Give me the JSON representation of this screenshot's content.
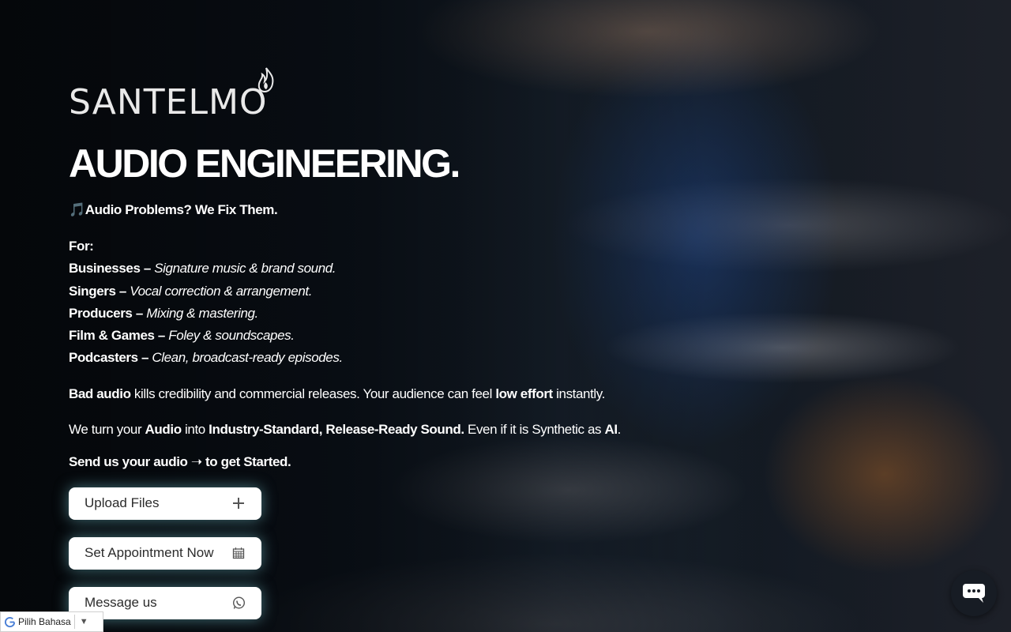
{
  "brand": {
    "logo_text": "SANTELMO"
  },
  "hero": {
    "headline": "AUDIO ENGINEERING.",
    "tagline": "🎵Audio Problems? We Fix Them."
  },
  "for_section": {
    "heading": "For:",
    "items": [
      {
        "name": "Businesses",
        "sep": " – ",
        "desc": "Signature music & brand sound."
      },
      {
        "name": "Singers",
        "sep": " – ",
        "desc": "Vocal correction & arrangement."
      },
      {
        "name": "Producers",
        "sep": " – ",
        "desc": "Mixing & mastering."
      },
      {
        "name": "Film & Games",
        "sep": " – ",
        "desc": "Foley & soundscapes."
      },
      {
        "name": "Podcasters",
        "sep": " – ",
        "desc": "Clean, broadcast-ready episodes."
      }
    ]
  },
  "para1": {
    "b1": "Bad audio",
    "t1": " kills credibility and commercial releases. Your audience can feel ",
    "b2": "low effort",
    "t2": " instantly."
  },
  "para2": {
    "t1": "We turn your ",
    "b1": "Audio",
    "t2": " into ",
    "b2": "Industry-Standard, Release-Ready Sound.",
    "t3": " Even if it is Synthetic as ",
    "b3": "AI",
    "t4": "."
  },
  "cta": "Send us your audio ➝ to get Started.",
  "buttons": {
    "upload": {
      "label": "Upload Files",
      "icon": "plus-icon"
    },
    "appointment": {
      "label": "Set Appointment Now",
      "icon": "calendar-icon"
    },
    "message": {
      "label": "Message us",
      "icon": "whatsapp-icon"
    }
  },
  "language_selector": {
    "label": "Pilih Bahasa",
    "icon": "google-icon"
  },
  "chat_widget": {
    "icon": "chat-icon"
  },
  "colors": {
    "button_glow": "#78c8d2",
    "text": "#ffffff"
  }
}
